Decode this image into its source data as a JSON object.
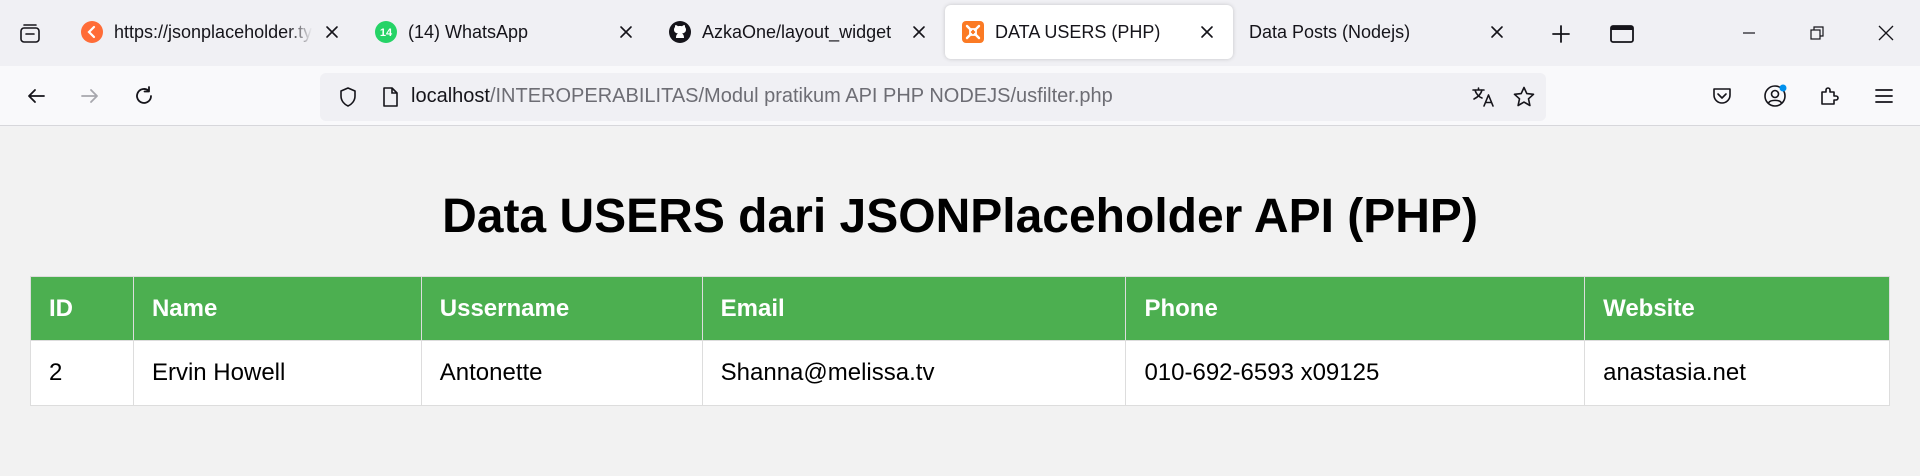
{
  "browser": {
    "tabs": [
      {
        "title": "https://jsonplaceholder.typicode.com/users",
        "icon": "postman-icon",
        "active": false
      },
      {
        "title": "(14) WhatsApp",
        "icon": "whatsapp-icon",
        "badge": "14",
        "active": false
      },
      {
        "title": "AzkaOne/layout_widget",
        "icon": "github-icon",
        "active": false
      },
      {
        "title": "DATA USERS (PHP)",
        "icon": "xampp-icon",
        "active": true
      },
      {
        "title": "Data Posts (Nodejs)",
        "icon": "",
        "active": false
      }
    ],
    "url": {
      "host": "localhost",
      "path": "/INTEROPERABILITAS/Modul pratikum API PHP NODEJS/usfilter.php"
    },
    "colors": {
      "accent": "#ff6c37",
      "whatsapp": "#25d366",
      "xampp": "#fb7a24"
    }
  },
  "page": {
    "title": "Data USERS dari JSONPlaceholder API (PHP)",
    "table": {
      "headers": [
        "ID",
        "Name",
        "Ussername",
        "Email",
        "Phone",
        "Website"
      ],
      "rows": [
        [
          "2",
          "Ervin Howell",
          "Antonette",
          "Shanna@melissa.tv",
          "010-692-6593 x09125",
          "anastasia.net"
        ]
      ]
    },
    "colors": {
      "header_bg": "#4caf50"
    }
  }
}
